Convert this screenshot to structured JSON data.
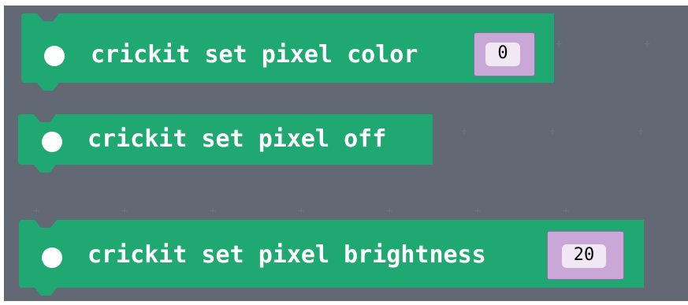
{
  "colors": {
    "workspace": "#626874",
    "block": "#20a873",
    "slot": "#c9a7d6",
    "field": "#f2e8f5"
  },
  "blocks": [
    {
      "label": "crickit set pixel color",
      "value": "0",
      "icon": "white-dot-icon"
    },
    {
      "label": "crickit set pixel off",
      "icon": "white-dot-icon"
    },
    {
      "label": "crickit set pixel brightness",
      "value": "20",
      "icon": "white-dot-icon"
    }
  ]
}
